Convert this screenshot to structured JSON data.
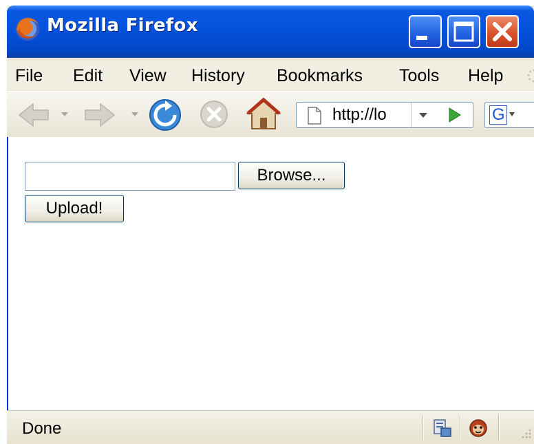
{
  "window": {
    "title": "Mozilla Firefox"
  },
  "menu": {
    "items": [
      "File",
      "Edit",
      "View",
      "History",
      "Bookmarks",
      "Tools",
      "Help"
    ]
  },
  "toolbar": {
    "icons": [
      "back-icon",
      "forward-icon",
      "reload-icon",
      "stop-icon",
      "home-icon"
    ],
    "url": "http://lo",
    "search_engine": "G"
  },
  "page": {
    "browse_label": "Browse...",
    "upload_label": "Upload!"
  },
  "status": {
    "text": "Done"
  },
  "colors": {
    "titlebar": "#0553dd",
    "close": "#d9522e",
    "chrome": "#ece9d8",
    "go_arrow": "#3aa63a"
  }
}
